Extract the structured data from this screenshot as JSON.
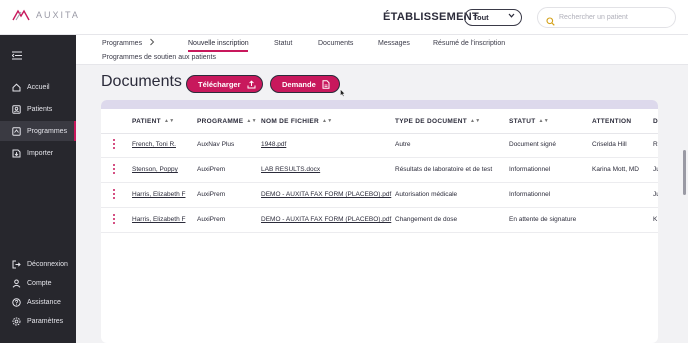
{
  "header": {
    "logo_text": "AUXITA",
    "etablissement_label": "ÉTABLISSEMENT",
    "etablissement_value": "Tout",
    "search_placeholder": "Rechercher un patient"
  },
  "sidebar": {
    "items": [
      {
        "label": "Accueil",
        "icon": "home-icon"
      },
      {
        "label": "Patients",
        "icon": "patients-icon"
      },
      {
        "label": "Programmes",
        "icon": "programs-icon",
        "active": true
      },
      {
        "label": "Importer",
        "icon": "import-icon"
      }
    ],
    "bottom_items": [
      {
        "label": "Déconnexion",
        "icon": "logout-icon"
      },
      {
        "label": "Compte",
        "icon": "user-icon"
      },
      {
        "label": "Assistance",
        "icon": "help-icon"
      },
      {
        "label": "Paramètres",
        "icon": "gear-icon"
      }
    ]
  },
  "subnav": {
    "breadcrumb": "Programmes",
    "tabs": [
      "Nouvelle inscription",
      "Statut",
      "Documents",
      "Messages",
      "Résumé de l'inscription"
    ],
    "active_tab": "Nouvelle inscription",
    "secondary": "Programmes de soutien aux patients"
  },
  "main": {
    "title": "Documents",
    "download_button": "Télécharger",
    "request_button": "Demande"
  },
  "table": {
    "columns": [
      "PATIENT",
      "PROGRAMME",
      "NOM DE FICHIER",
      "TYPE DE DOCUMENT",
      "STATUT",
      "ATTENTION",
      "D"
    ],
    "rows": [
      {
        "patient": "French, Toni R.",
        "programme": "AuxNav Plus",
        "fichier": "1948.pdf",
        "type": "Autre",
        "statut": "Document signé",
        "attention": "Criselda Hill",
        "extra": "R"
      },
      {
        "patient": "Stenson, Poppy",
        "programme": "AuxiPrem",
        "fichier": "LAB RESULTS.docx",
        "type": "Résultats de laboratoire et de test",
        "statut": "Informationnel",
        "attention": "Karina Mott, MD",
        "extra": "Ju"
      },
      {
        "patient": "Harris, Elizabeth F",
        "programme": "AuxiPrem",
        "fichier": "DEMO - AUXITA FAX FORM (PLACEBO).pdf",
        "type": "Autorisation médicale",
        "statut": "Informationnel",
        "attention": "",
        "extra": "Ju"
      },
      {
        "patient": "Harris, Elizabeth F",
        "programme": "AuxiPrem",
        "fichier": "DEMO - AUXITA FAX FORM (PLACEBO).pdf",
        "type": "Changement de dose",
        "statut": "En attente de signature",
        "attention": "",
        "extra": "K"
      }
    ]
  },
  "colors": {
    "accent": "#c8185c",
    "sidebar": "#27272d",
    "table_header_band": "#ddd9ec"
  }
}
